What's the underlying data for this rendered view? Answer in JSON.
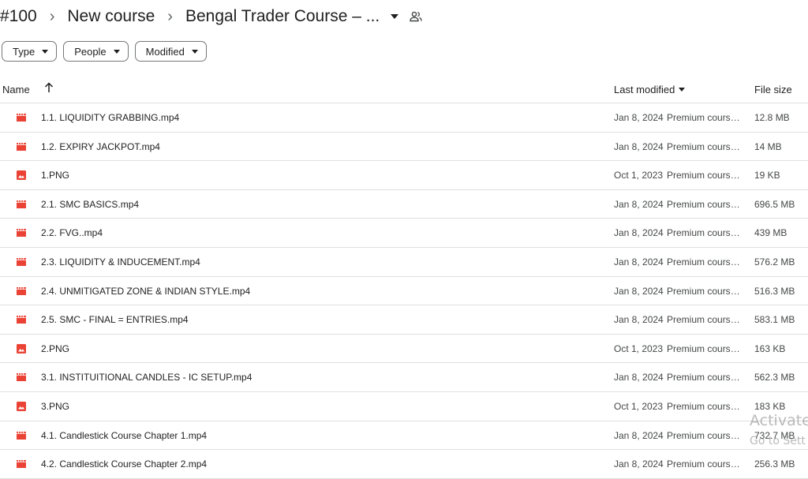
{
  "breadcrumb": {
    "items": [
      "#100",
      "New course",
      "Bengal Trader Course – ..."
    ],
    "separator": "›"
  },
  "filters": [
    {
      "label": "Type"
    },
    {
      "label": "People"
    },
    {
      "label": "Modified"
    }
  ],
  "columns": {
    "name": "Name",
    "last_modified": "Last modified",
    "file_size": "File size"
  },
  "files": [
    {
      "type": "video",
      "name": "1.1. LIQUIDITY GRABBING.mp4",
      "date": "Jan 8, 2024",
      "owner": "Premium course...",
      "size": "12.8 MB"
    },
    {
      "type": "video",
      "name": "1.2. EXPIRY JACKPOT.mp4",
      "date": "Jan 8, 2024",
      "owner": "Premium course...",
      "size": "14 MB"
    },
    {
      "type": "image",
      "name": "1.PNG",
      "date": "Oct 1, 2023",
      "owner": "Premium course...",
      "size": "19 KB"
    },
    {
      "type": "video",
      "name": "2.1. SMC BASICS.mp4",
      "date": "Jan 8, 2024",
      "owner": "Premium course...",
      "size": "696.5 MB"
    },
    {
      "type": "video",
      "name": "2.2. FVG..mp4",
      "date": "Jan 8, 2024",
      "owner": "Premium course...",
      "size": "439 MB"
    },
    {
      "type": "video",
      "name": "2.3. LIQUIDITY & INDUCEMENT.mp4",
      "date": "Jan 8, 2024",
      "owner": "Premium course...",
      "size": "576.2 MB"
    },
    {
      "type": "video",
      "name": "2.4. UNMITIGATED ZONE & INDIAN STYLE.mp4",
      "date": "Jan 8, 2024",
      "owner": "Premium course...",
      "size": "516.3 MB"
    },
    {
      "type": "video",
      "name": "2.5. SMC - FINAL = ENTRIES.mp4",
      "date": "Jan 8, 2024",
      "owner": "Premium course...",
      "size": "583.1 MB"
    },
    {
      "type": "image",
      "name": "2.PNG",
      "date": "Oct 1, 2023",
      "owner": "Premium course...",
      "size": "163 KB"
    },
    {
      "type": "video",
      "name": "3.1. INSTITUITIONAL CANDLES - IC SETUP.mp4",
      "date": "Jan 8, 2024",
      "owner": "Premium course...",
      "size": "562.3 MB"
    },
    {
      "type": "image",
      "name": "3.PNG",
      "date": "Oct 1, 2023",
      "owner": "Premium course...",
      "size": "183 KB"
    },
    {
      "type": "video",
      "name": "4.1. Candlestick Course Chapter 1.mp4",
      "date": "Jan 8, 2024",
      "owner": "Premium course...",
      "size": "732.7 MB"
    },
    {
      "type": "video",
      "name": "4.2. Candlestick Course Chapter 2.mp4",
      "date": "Jan 8, 2024",
      "owner": "Premium course...",
      "size": "256.3 MB"
    }
  ],
  "watermark": {
    "line1": "Activate",
    "line2": "Go to Sett"
  },
  "colors": {
    "file_icon_red": "#ea4335",
    "divider": "#e0e0e0"
  },
  "icons": {
    "video": "video-file-icon",
    "image": "image-file-icon"
  }
}
